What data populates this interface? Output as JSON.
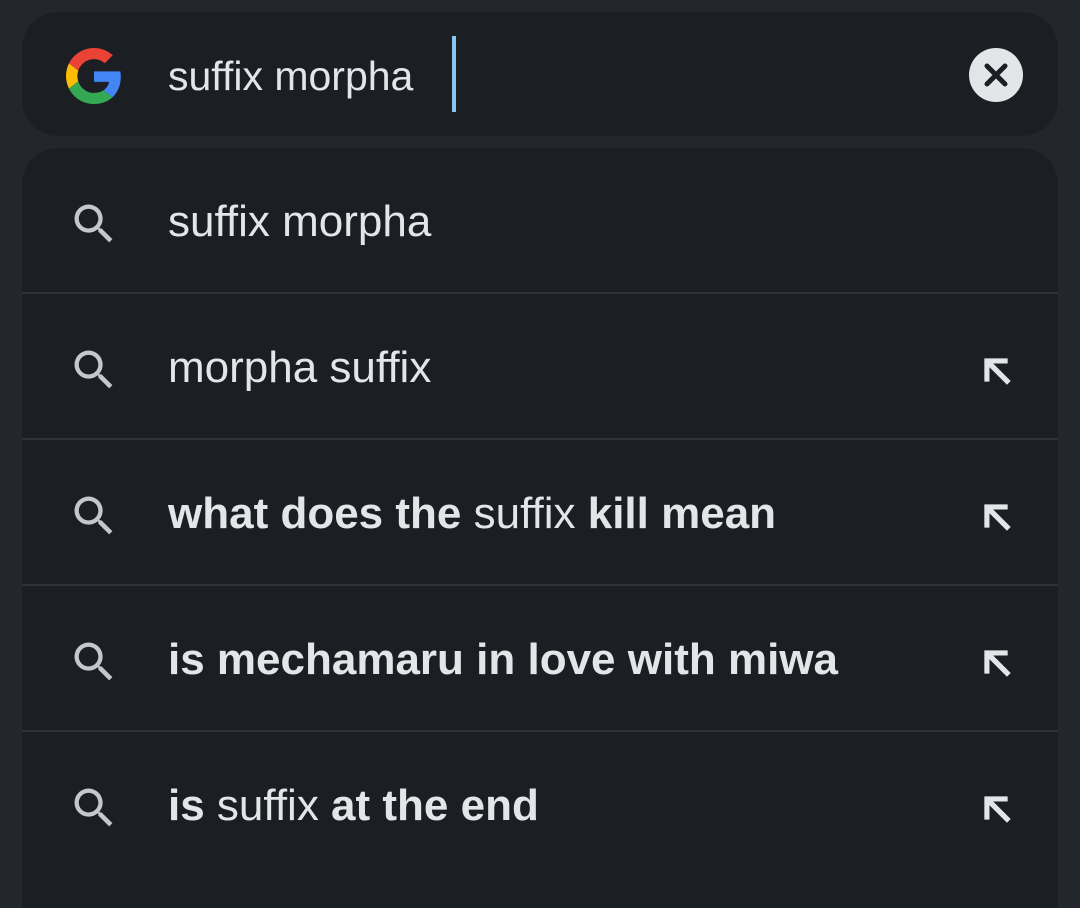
{
  "search": {
    "query": "suffix morpha"
  },
  "icons": {
    "logo": "google-g-icon",
    "clear": "close-icon",
    "search": "search-icon",
    "fill": "arrow-up-left-icon"
  },
  "colors": {
    "background": "#23272d",
    "surface": "#1b1e22",
    "text": "#e3e5e8",
    "caret": "#8ac7f0",
    "google_blue": "#4285F4",
    "google_red": "#EA4335",
    "google_yellow": "#FBBC05",
    "google_green": "#34A853"
  },
  "suggestions": [
    {
      "parts": [
        "suffix morpha"
      ],
      "weights": [
        "normal"
      ],
      "has_fill_arrow": false
    },
    {
      "parts": [
        "morpha suffix"
      ],
      "weights": [
        "normal"
      ],
      "has_fill_arrow": true
    },
    {
      "parts": [
        "what does the ",
        "suffix",
        " kill mean"
      ],
      "weights": [
        "bold",
        "normal",
        "bold"
      ],
      "has_fill_arrow": true
    },
    {
      "parts": [
        "is mechamaru in love with miwa"
      ],
      "weights": [
        "bold"
      ],
      "has_fill_arrow": true
    },
    {
      "parts": [
        "is ",
        "suffix",
        " at the end"
      ],
      "weights": [
        "bold",
        "normal",
        "bold"
      ],
      "has_fill_arrow": true
    }
  ]
}
